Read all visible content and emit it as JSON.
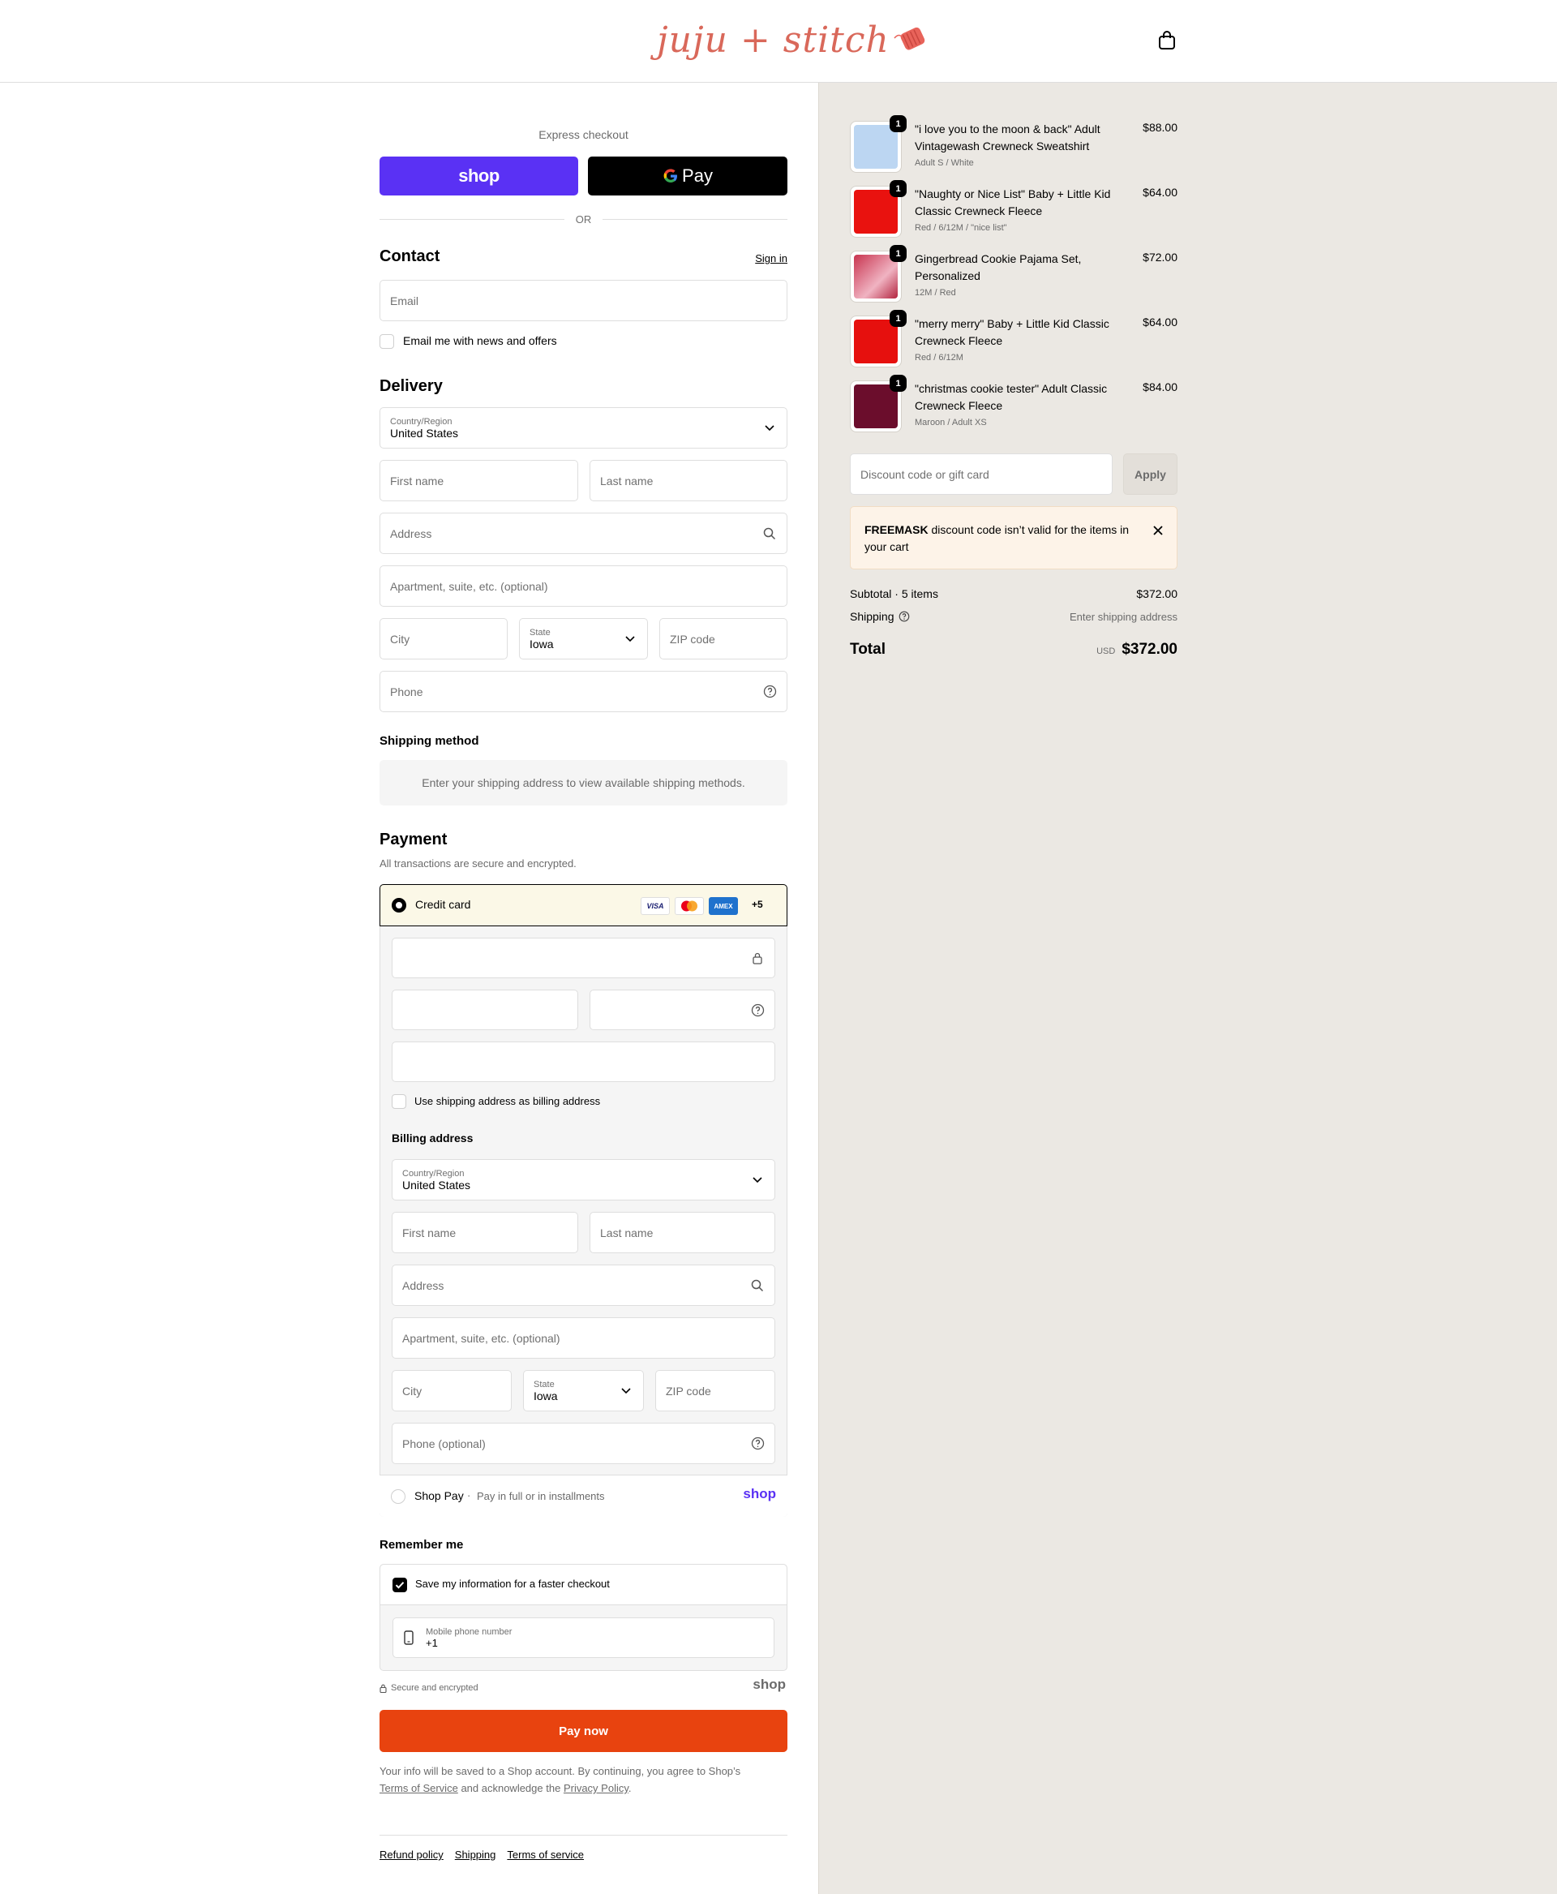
{
  "header": {
    "logo_text": "juju + stitch",
    "cart_icon": "shopping-bag-icon"
  },
  "express": {
    "label": "Express checkout",
    "shop_label": "shop",
    "gpay_label": "Pay",
    "or_label": "OR"
  },
  "contact": {
    "title": "Contact",
    "sign_in": "Sign in",
    "email_placeholder": "Email",
    "newsletter_label": "Email me with news and offers"
  },
  "delivery": {
    "title": "Delivery",
    "country_label": "Country/Region",
    "country_value": "United States",
    "first_name": "First name",
    "last_name": "Last name",
    "address": "Address",
    "apartment": "Apartment, suite, etc. (optional)",
    "city": "City",
    "state_label": "State",
    "state_value": "Iowa",
    "zip": "ZIP code",
    "phone": "Phone"
  },
  "shipping_method": {
    "title": "Shipping method",
    "message": "Enter your shipping address to view available shipping methods."
  },
  "payment": {
    "title": "Payment",
    "subtitle": "All transactions are secure and encrypted.",
    "credit_card_label": "Credit card",
    "card_logos": [
      "VISA",
      "MC",
      "AMEX"
    ],
    "more_cards": "+5",
    "use_shipping_label": "Use shipping address as billing address",
    "billing_title": "Billing address",
    "billing": {
      "country_label": "Country/Region",
      "country_value": "United States",
      "first_name": "First name",
      "last_name": "Last name",
      "address": "Address",
      "apartment": "Apartment, suite, etc. (optional)",
      "city": "City",
      "state_label": "State",
      "state_value": "Iowa",
      "zip": "ZIP code",
      "phone": "Phone (optional)"
    },
    "shop_pay_label": "Shop Pay",
    "shop_pay_desc": "Pay in full or in installments",
    "shop_logo": "shop"
  },
  "remember": {
    "title": "Remember me",
    "save_label": "Save my information for a faster checkout",
    "mobile_label": "Mobile phone number",
    "mobile_value": "+1",
    "secure_label": "Secure and encrypted",
    "shop_logo": "shop"
  },
  "pay_now": "Pay now",
  "legal": {
    "text1": "Your info will be saved to a Shop account. By continuing, you agree to Shop’s",
    "terms": "Terms of Service",
    "text2": "and acknowledge the",
    "privacy": "Privacy Policy",
    "text3": "."
  },
  "footer": {
    "links": [
      "Refund policy",
      "Shipping",
      "Terms of service"
    ]
  },
  "summary": {
    "items": [
      {
        "qty": "1",
        "name": "\"i love you to the moon & back\" Adult Vintagewash Crewneck Sweatshirt",
        "variant": "Adult S / White",
        "price": "$88.00",
        "color": "#bcd6f2"
      },
      {
        "qty": "1",
        "name": "\"Naughty or Nice List\" Baby + Little Kid Classic Crewneck Fleece",
        "variant": "Red / 6/12M / \"nice list\"",
        "price": "$64.00",
        "color": "#e9120f"
      },
      {
        "qty": "1",
        "name": "Gingerbread Cookie Pajama Set, Personalized",
        "variant": "12M / Red",
        "price": "$72.00",
        "color": "#c8344f"
      },
      {
        "qty": "1",
        "name": "\"merry merry\" Baby + Little Kid Classic Crewneck Fleece",
        "variant": "Red / 6/12M",
        "price": "$64.00",
        "color": "#e6100e"
      },
      {
        "qty": "1",
        "name": "\"christmas cookie tester\" Adult Classic Crewneck Fleece",
        "variant": "Maroon / Adult XS",
        "price": "$84.00",
        "color": "#6b0d2c"
      }
    ],
    "discount_placeholder": "Discount code or gift card",
    "apply_label": "Apply",
    "alert_code": "FREEMASK",
    "alert_text": "discount code isn’t valid for the items in your cart",
    "subtotal_label": "Subtotal · 5 items",
    "subtotal_value": "$372.00",
    "shipping_label": "Shipping",
    "shipping_value": "Enter shipping address",
    "total_label": "Total",
    "currency": "USD",
    "total_value": "$372.00"
  }
}
